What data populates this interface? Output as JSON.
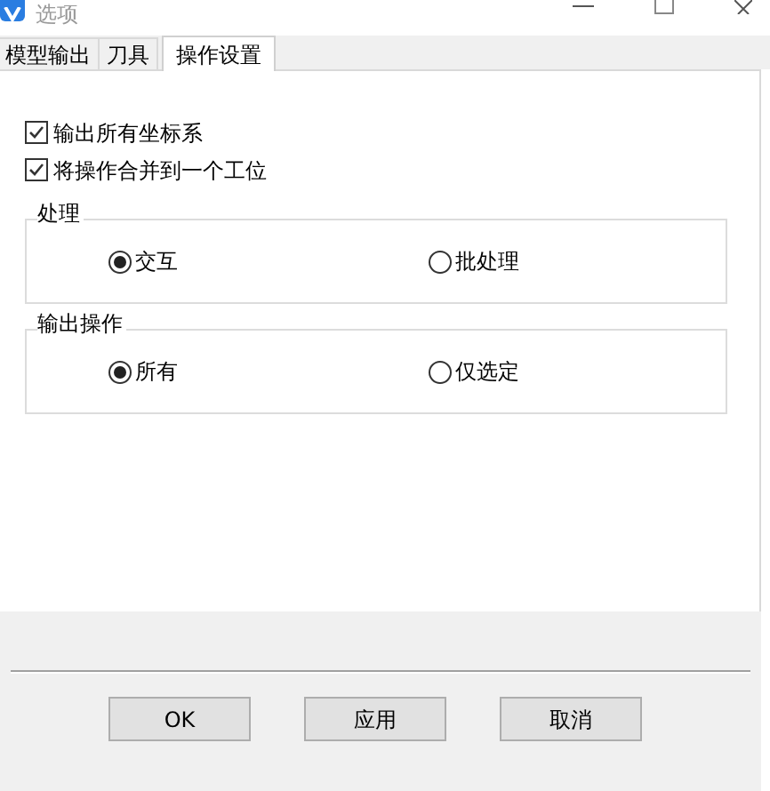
{
  "window": {
    "title": "选项"
  },
  "tabs": [
    {
      "label": "模型输出",
      "selected": false
    },
    {
      "label": "刀具",
      "selected": false
    },
    {
      "label": "操作设置",
      "selected": true
    }
  ],
  "checkboxes": [
    {
      "label": "输出所有坐标系",
      "checked": true
    },
    {
      "label": "将操作合并到一个工位",
      "checked": true
    }
  ],
  "groups": [
    {
      "title": "处理",
      "options": [
        {
          "label": "交互",
          "selected": true
        },
        {
          "label": "批处理",
          "selected": false
        }
      ]
    },
    {
      "title": "输出操作",
      "options": [
        {
          "label": "所有",
          "selected": true
        },
        {
          "label": "仅选定",
          "selected": false
        }
      ]
    }
  ],
  "buttons": [
    "OK",
    "应用",
    "取消"
  ]
}
